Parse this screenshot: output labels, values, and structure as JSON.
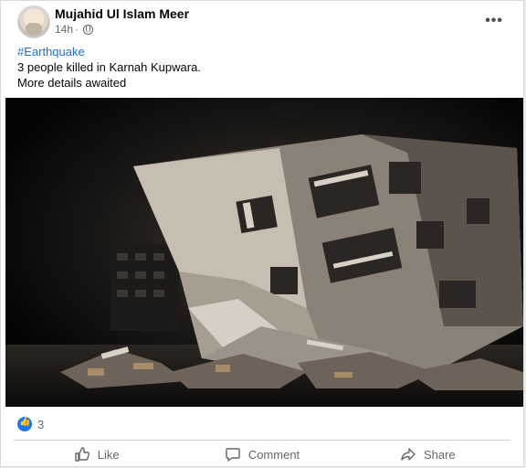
{
  "post": {
    "author": "Mujahid Ul Islam Meer",
    "time": "14h",
    "time_separator": "·",
    "hashtag": "#Earthquake",
    "line1": "3 people killed in Karnah Kupwara.",
    "line2": "More details awaited"
  },
  "reactions": {
    "count": "3"
  },
  "actions": {
    "like": "Like",
    "comment": "Comment",
    "share": "Share"
  },
  "colors": {
    "link": "#216fdb",
    "like_badge": "#1877f2",
    "muted_text": "#65676b"
  },
  "icons": [
    "globe-icon",
    "more-options-icon",
    "like-icon",
    "comment-icon",
    "share-icon"
  ]
}
